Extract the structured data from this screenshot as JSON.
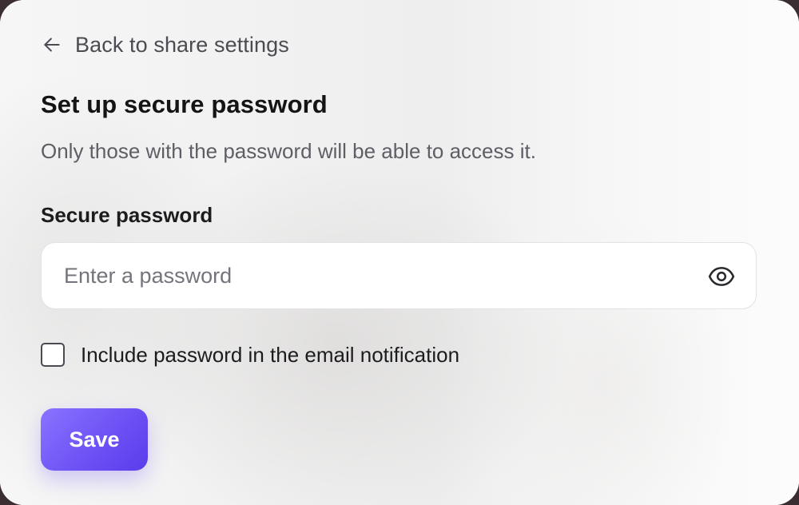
{
  "back_link": {
    "label": "Back to share settings",
    "icon": "arrow-left-icon"
  },
  "dialog": {
    "title": "Set up secure password",
    "subtitle": "Only those with the password will be able to access it."
  },
  "password_field": {
    "label": "Secure password",
    "placeholder": "Enter a password",
    "value": "",
    "toggle_icon": "eye-icon"
  },
  "email_option": {
    "label": "Include password in the email notification",
    "checked": false
  },
  "actions": {
    "save_label": "Save"
  },
  "colors": {
    "accent": "#6e52f5",
    "accent_light": "#8a73ff",
    "title_text": "#141416",
    "muted_text": "#5e5e66"
  }
}
